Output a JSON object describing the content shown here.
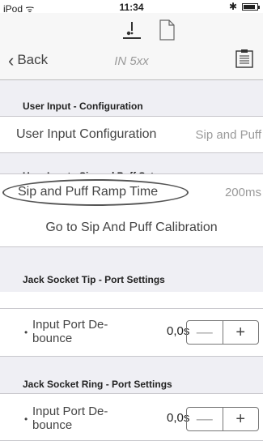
{
  "status_bar": {
    "carrier": "iPod ᯤ",
    "time": "11:34",
    "bluetooth": "✱"
  },
  "nav": {
    "back_label": "Back",
    "title": "IN 5xx"
  },
  "sections": {
    "configuration": {
      "header": "User Input - Configuration",
      "row_label": "User Input Configuration",
      "row_value": "Sip and Puff"
    },
    "sip_puff": {
      "header": "User Input - Sip and Puff Setup",
      "row_label": "Sip and Puff Ramp Time",
      "row_value": "200ms",
      "calibration_label": "Go to Sip And Puff Calibration"
    },
    "tip": {
      "header": "Jack Socket Tip - Port Settings",
      "label": "Input Port De-\nbounce",
      "value": "0,0s",
      "minus": "—",
      "plus": "+"
    },
    "ring": {
      "header": "Jack Socket Ring - Port Settings",
      "label": "Input Port De-\nbounce",
      "value": "0,0s",
      "minus": "—",
      "plus": "+"
    }
  }
}
